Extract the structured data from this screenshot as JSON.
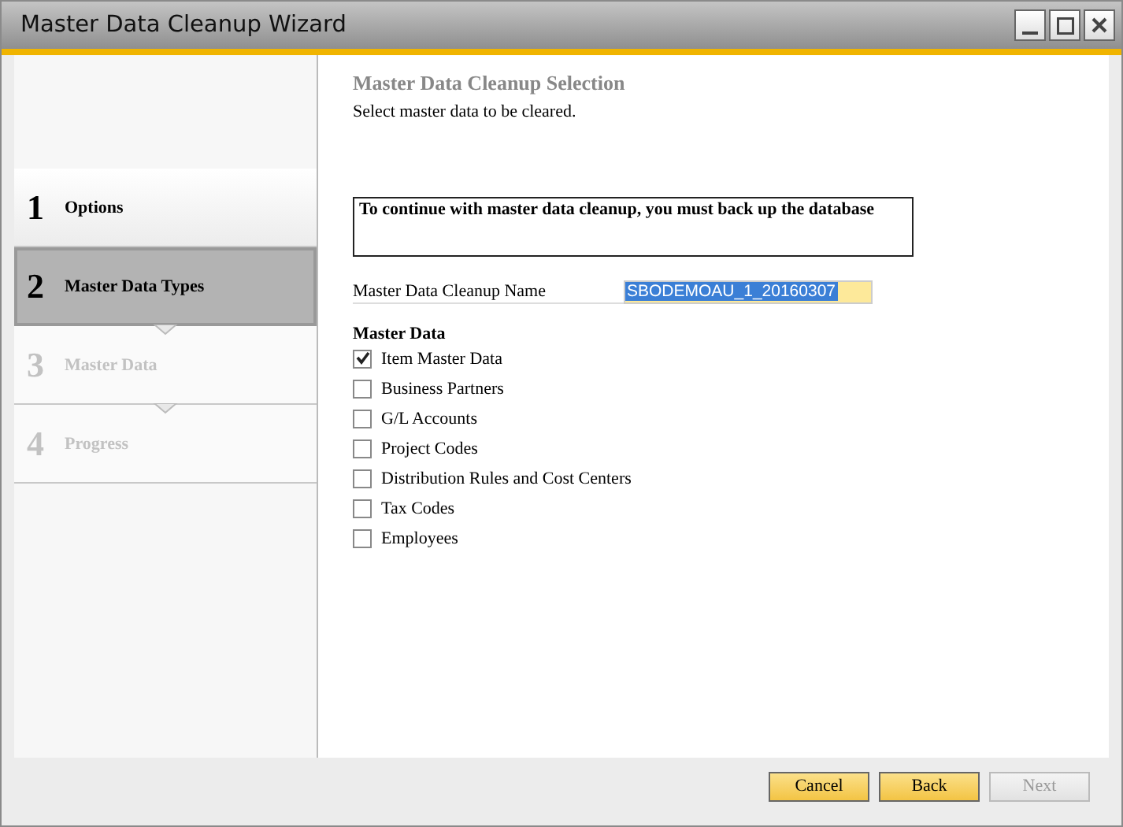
{
  "window": {
    "title": "Master Data Cleanup Wizard"
  },
  "steps": [
    {
      "number": "1",
      "label": "Options",
      "selected": false,
      "disabled": false
    },
    {
      "number": "2",
      "label": "Master Data Types",
      "selected": true,
      "disabled": false
    },
    {
      "number": "3",
      "label": "Master Data",
      "selected": false,
      "disabled": true
    },
    {
      "number": "4",
      "label": "Progress",
      "selected": false,
      "disabled": true
    }
  ],
  "page": {
    "title": "Master Data Cleanup Selection",
    "subtitle": "Select master data to be cleared.",
    "notice": "To continue with master data cleanup, you must back up the database",
    "name_label": "Master Data Cleanup Name",
    "name_value": "SBODEMOAU_1_20160307",
    "section": "Master Data"
  },
  "options": [
    {
      "label": "Item Master Data",
      "checked": true
    },
    {
      "label": "Business Partners",
      "checked": false
    },
    {
      "label": "G/L Accounts",
      "checked": false
    },
    {
      "label": "Project Codes",
      "checked": false
    },
    {
      "label": "Distribution Rules and Cost Centers",
      "checked": false
    },
    {
      "label": "Tax Codes",
      "checked": false
    },
    {
      "label": "Employees",
      "checked": false
    }
  ],
  "buttons": [
    {
      "label": "Cancel",
      "disabled": false
    },
    {
      "label": "Back",
      "disabled": false
    },
    {
      "label": "Next",
      "disabled": true
    }
  ]
}
